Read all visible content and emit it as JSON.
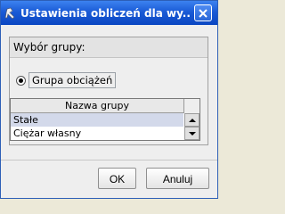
{
  "window": {
    "title": "Ustawienia obliczeń dla wy..."
  },
  "group": {
    "title": "Wybór grupy:"
  },
  "radio": {
    "label": "Grupa obciążeń",
    "checked": true
  },
  "table": {
    "header": "Nazwa grupy",
    "rows": [
      "Stałe",
      "Ciężar własny"
    ],
    "selected_index": 0
  },
  "buttons": {
    "ok": "OK",
    "cancel": "Anuluj"
  },
  "icons": {
    "app": "robot-app-icon",
    "close": "close-icon",
    "up": "scroll-up-arrow-icon",
    "down": "scroll-down-arrow-icon"
  }
}
